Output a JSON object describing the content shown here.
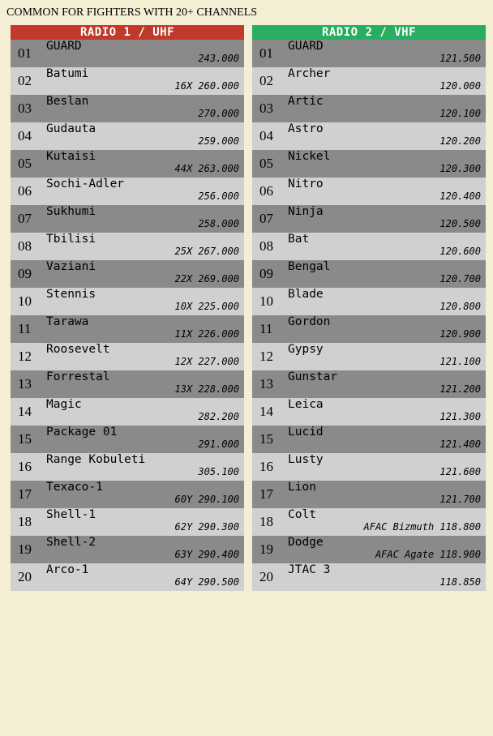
{
  "page": {
    "title": "COMMON FOR FIGHTERS WITH 20+ CHANNELS"
  },
  "colors": {
    "background": "#f4eed5",
    "uhf_header": "#c0392b",
    "vhf_header": "#27ae60",
    "row_dark": "#8a8a8a",
    "row_light": "#d0d0d0"
  },
  "radios": [
    {
      "title": "RADIO 1 / UHF",
      "channels": [
        {
          "num": "01",
          "name": "GUARD",
          "freq": "243.000"
        },
        {
          "num": "02",
          "name": "Batumi",
          "freq": "16X 260.000"
        },
        {
          "num": "03",
          "name": "Beslan",
          "freq": "270.000"
        },
        {
          "num": "04",
          "name": "Gudauta",
          "freq": "259.000"
        },
        {
          "num": "05",
          "name": "Kutaisi",
          "freq": "44X 263.000"
        },
        {
          "num": "06",
          "name": "Sochi-Adler",
          "freq": "256.000"
        },
        {
          "num": "07",
          "name": "Sukhumi",
          "freq": "258.000"
        },
        {
          "num": "08",
          "name": "Tbilisi",
          "freq": "25X 267.000"
        },
        {
          "num": "09",
          "name": "Vaziani",
          "freq": "22X 269.000"
        },
        {
          "num": "10",
          "name": "Stennis",
          "freq": "10X 225.000"
        },
        {
          "num": "11",
          "name": "Tarawa",
          "freq": "11X 226.000"
        },
        {
          "num": "12",
          "name": "Roosevelt",
          "freq": "12X 227.000"
        },
        {
          "num": "13",
          "name": "Forrestal",
          "freq": "13X 228.000"
        },
        {
          "num": "14",
          "name": "Magic",
          "freq": "282.200"
        },
        {
          "num": "15",
          "name": "Package 01",
          "freq": "291.000"
        },
        {
          "num": "16",
          "name": "Range Kobuleti",
          "freq": "305.100"
        },
        {
          "num": "17",
          "name": "Texaco-1",
          "freq": "60Y 290.100"
        },
        {
          "num": "18",
          "name": "Shell-1",
          "freq": "62Y 290.300"
        },
        {
          "num": "19",
          "name": "Shell-2",
          "freq": "63Y 290.400"
        },
        {
          "num": "20",
          "name": "Arco-1",
          "freq": "64Y 290.500"
        }
      ]
    },
    {
      "title": "RADIO 2 / VHF",
      "channels": [
        {
          "num": "01",
          "name": "GUARD",
          "freq": "121.500"
        },
        {
          "num": "02",
          "name": "Archer",
          "freq": "120.000"
        },
        {
          "num": "03",
          "name": "Artic",
          "freq": "120.100"
        },
        {
          "num": "04",
          "name": "Astro",
          "freq": "120.200"
        },
        {
          "num": "05",
          "name": "Nickel",
          "freq": "120.300"
        },
        {
          "num": "06",
          "name": "Nitro",
          "freq": "120.400"
        },
        {
          "num": "07",
          "name": "Ninja",
          "freq": "120.500"
        },
        {
          "num": "08",
          "name": "Bat",
          "freq": "120.600"
        },
        {
          "num": "09",
          "name": "Bengal",
          "freq": "120.700"
        },
        {
          "num": "10",
          "name": "Blade",
          "freq": "120.800"
        },
        {
          "num": "11",
          "name": "Gordon",
          "freq": "120.900"
        },
        {
          "num": "12",
          "name": "Gypsy",
          "freq": "121.100"
        },
        {
          "num": "13",
          "name": "Gunstar",
          "freq": "121.200"
        },
        {
          "num": "14",
          "name": "Leica",
          "freq": "121.300"
        },
        {
          "num": "15",
          "name": "Lucid",
          "freq": "121.400"
        },
        {
          "num": "16",
          "name": "Lusty",
          "freq": "121.600"
        },
        {
          "num": "17",
          "name": "Lion",
          "freq": "121.700"
        },
        {
          "num": "18",
          "name": "Colt",
          "freq": "AFAC Bizmuth 118.800"
        },
        {
          "num": "19",
          "name": "Dodge",
          "freq": "AFAC Agate 118.900"
        },
        {
          "num": "20",
          "name": "JTAC 3",
          "freq": "118.850"
        }
      ]
    }
  ]
}
